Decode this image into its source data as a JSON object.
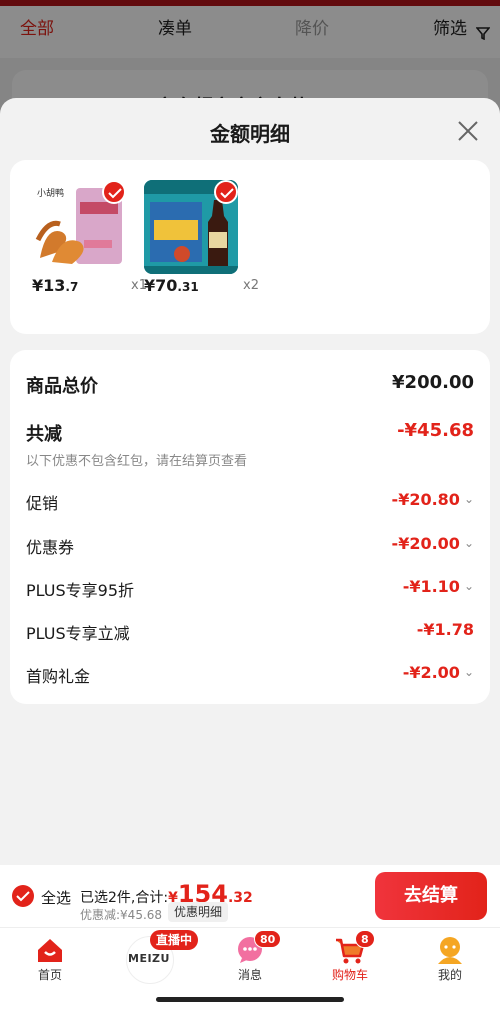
{
  "background": {
    "tabs": [
      "全部",
      "凑单",
      "降价",
      "筛选"
    ],
    "card_text": "京东超市官方自营"
  },
  "sheet": {
    "title": "金额明细",
    "products": [
      {
        "price_int": "¥13",
        "price_dec": ".7",
        "qty": "x1"
      },
      {
        "price_int": "¥70",
        "price_dec": ".31",
        "qty": "x2"
      }
    ],
    "total_label": "商品总价",
    "total_value": "¥200.00",
    "reduce_label": "共减",
    "reduce_value": "-¥45.68",
    "note": "以下优惠不包含红包，请在结算页查看",
    "items": [
      {
        "label": "促销",
        "value": "-¥20.80"
      },
      {
        "label": "优惠券",
        "value": "-¥20.00"
      },
      {
        "label": "PLUS专享95折",
        "value": "-¥1.10"
      },
      {
        "label": "PLUS专享立减",
        "value": "-¥1.78"
      },
      {
        "label": "首购礼金",
        "value": "-¥2.00"
      }
    ]
  },
  "checkout": {
    "select_all": "全选",
    "summary": "已选2件,合计:",
    "currency": "¥",
    "total_int": "154",
    "total_dec": ".32",
    "discount": "优惠减:¥45.68",
    "detail_chip": "优惠明细",
    "button": "去结算"
  },
  "tabbar": {
    "home": "首页",
    "live": "直播中",
    "meizu": "MEIZU",
    "messages": "消息",
    "messages_badge": "80",
    "cart": "购物车",
    "cart_badge": "8",
    "me": "我的"
  },
  "colors": {
    "accent": "#e2231a",
    "bg": "#f2f2f2"
  }
}
